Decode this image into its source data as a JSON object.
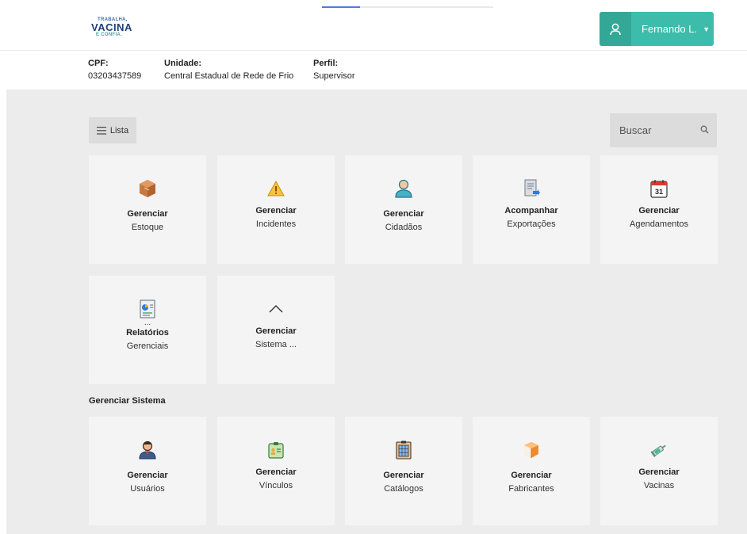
{
  "header": {
    "logo": {
      "line1": "TRABALHA,",
      "line2": "VACINA",
      "line3": "E CONFIA."
    },
    "loading_progress": 0.22,
    "user": {
      "name": "Fernando L."
    }
  },
  "info": {
    "cpf": {
      "label": "CPF:",
      "value": "03203437589"
    },
    "unidade": {
      "label": "Unidade:",
      "value": "Central Estadual de Rede de Frio"
    },
    "perfil": {
      "label": "Perfil:",
      "value": "Supervisor"
    }
  },
  "toolbar": {
    "lista_label": "Lista",
    "search_placeholder": "Buscar"
  },
  "cards": [
    {
      "title": "Gerenciar",
      "subtitle": "Estoque",
      "icon": "box-icon"
    },
    {
      "title": "Gerenciar",
      "subtitle": "Incidentes",
      "icon": "warning-icon"
    },
    {
      "title": "Gerenciar",
      "subtitle": "Cidadãos",
      "icon": "person-icon"
    },
    {
      "title": "Acompanhar",
      "subtitle": "Exportações",
      "icon": "export-document-icon"
    },
    {
      "title": "Gerenciar",
      "subtitle": "Agendamentos",
      "icon": "calendar-icon"
    },
    {
      "dots": "...",
      "title": "Relatórios",
      "subtitle": "Gerenciais",
      "icon": "report-chart-icon"
    },
    {
      "title": "Gerenciar",
      "subtitle": "Sistema ...",
      "icon": "chevron-up-icon"
    }
  ],
  "calendar_day": "31",
  "section": {
    "title": "Gerenciar Sistema"
  },
  "system_cards": [
    {
      "title": "Gerenciar",
      "subtitle": "Usuários",
      "icon": "user-badge-icon"
    },
    {
      "title": "Gerenciar",
      "subtitle": "Vínculos",
      "icon": "id-card-icon"
    },
    {
      "title": "Gerenciar",
      "subtitle": "Catálogos",
      "icon": "catalog-icon"
    },
    {
      "title": "Gerenciar",
      "subtitle": "Fabricantes",
      "icon": "factory-box-icon"
    },
    {
      "title": "Gerenciar",
      "subtitle": "Vacinas",
      "icon": "syringe-icon"
    }
  ],
  "colors": {
    "accent": "#3dbcab",
    "accent_dark": "#33a897",
    "background": "#ececec",
    "card": "#f4f4f4"
  }
}
